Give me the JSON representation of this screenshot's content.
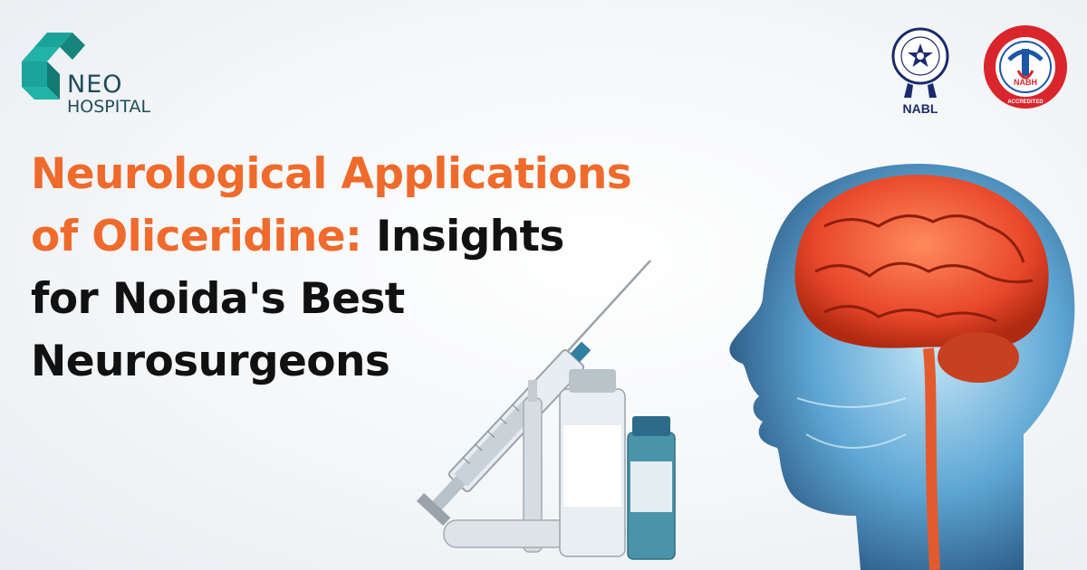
{
  "logo": {
    "line1": "NEO",
    "line2": "HOSPITAL"
  },
  "headline": {
    "line1_accent": "Neurological Applications",
    "line2_accent": "of Oliceridine:",
    "line2_rest": "Insights",
    "line3": "for Noida's Best",
    "line4": "Neurosurgeons"
  },
  "badges": {
    "nabl_label": "NABL",
    "nabh_center": "NABH",
    "nabh_bottom": "ACCREDITED"
  },
  "colors": {
    "accent": "#ef6a2b",
    "text": "#111111",
    "logo_teal": "#1aa39a",
    "logo_dark": "#1f4b5b",
    "brain": "#e8472a",
    "nabh_red": "#d9252b",
    "nabl_blue": "#1b2a6b"
  }
}
